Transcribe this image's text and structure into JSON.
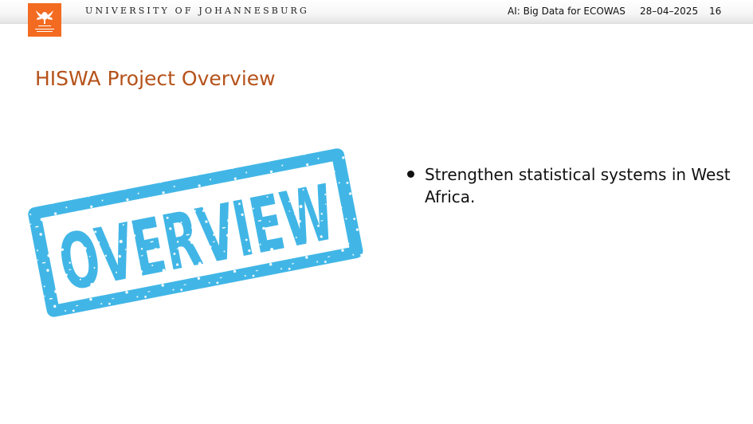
{
  "header": {
    "university": "UNIVERSITY OF JOHANNESBURG",
    "short_title": "AI: Big Data for ECOWAS",
    "date": "28–04–2025",
    "page_number": "16",
    "colors": {
      "brand_orange": "#f26b21",
      "title_orange": "#b5521a"
    }
  },
  "slide": {
    "title": "HISWA Project Overview",
    "stamp_text": "OVERVIEW",
    "stamp_color": "#41b6e6",
    "bullets": [
      "Strengthen statistical systems in West Africa."
    ]
  },
  "icons": [
    "university-logo-icon",
    "overview-stamp-icon",
    "bullet-icon"
  ]
}
